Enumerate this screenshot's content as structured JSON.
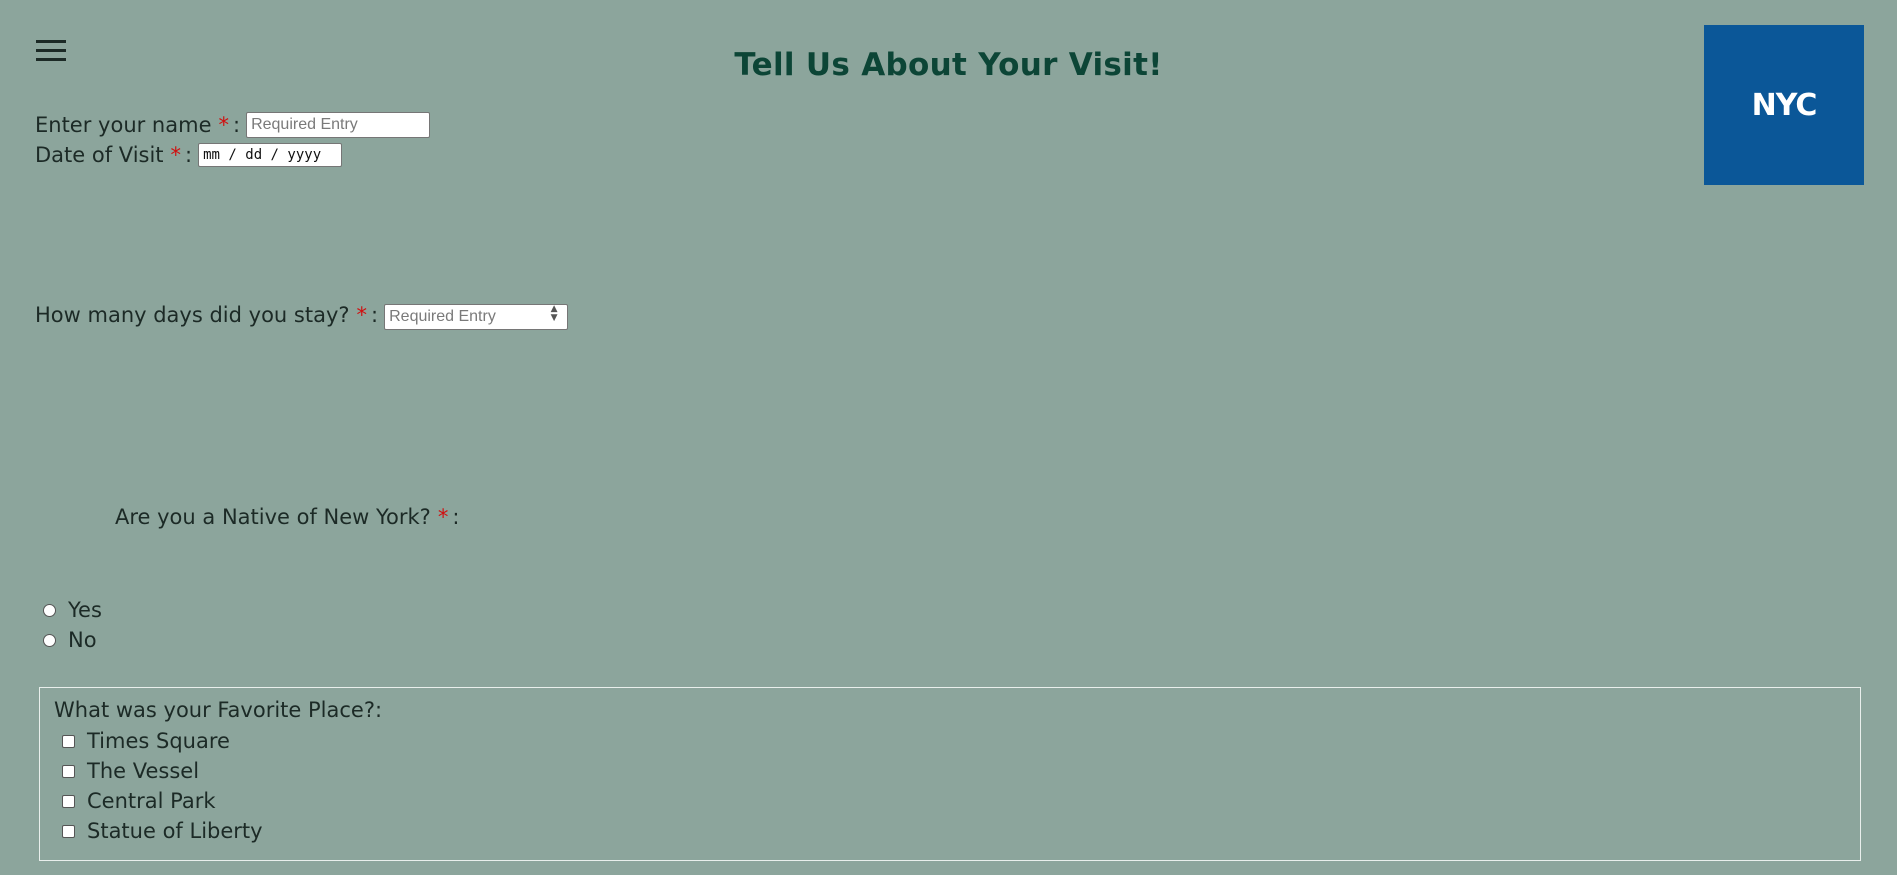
{
  "header": {
    "menu_icon": "hamburger-menu-icon",
    "title": "Tell Us About Your Visit!",
    "logo_text": "NYC"
  },
  "form": {
    "name": {
      "label": "Enter your name",
      "required_mark": "*",
      "colon": ":",
      "placeholder": "Required Entry"
    },
    "date": {
      "label": "Date of Visit",
      "required_mark": "*",
      "colon": ":",
      "placeholder": "mm / dd / yyyy"
    },
    "days": {
      "label": "How many days did you stay?",
      "required_mark": "*",
      "colon": ":",
      "placeholder": "Required Entry"
    },
    "native": {
      "label": "Are you a Native of New York?",
      "required_mark": "*",
      "colon": ":",
      "options": [
        "Yes",
        "No"
      ]
    },
    "favorite": {
      "label": "What was your Favorite Place?:",
      "options": [
        "Times Square",
        "The Vessel",
        "Central Park",
        "Statue of Liberty"
      ]
    }
  },
  "colors": {
    "background": "#8ca59c",
    "title": "#0c4536",
    "logo_bg": "#0b5798",
    "required": "#d01010"
  }
}
